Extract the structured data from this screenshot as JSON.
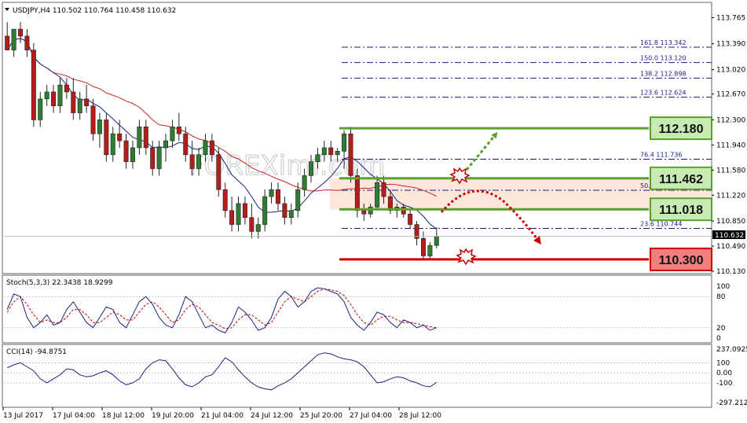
{
  "main_header": "USDJPY,H4  110.502 110.764 110.458 110.632",
  "stoch_header": "Stoch(5,3,3) 22.3438 18.9299",
  "cci_header": "CCI(14) -94.8751",
  "watermark": "FOREXimf.com",
  "price_tag": "110.632",
  "colors": {
    "bull": "#2e7d32",
    "bear": "#b71c1c",
    "ma_fast": "#1a237e",
    "ma_slow": "#c62828",
    "level_green": "#5aa02c",
    "level_red": "#cc0000",
    "fib": "#1a1a8c",
    "box_green": "#c8eab4",
    "box_red": "#f08080",
    "zone": "#fbe3d3"
  },
  "chart_data": [
    {
      "type": "candlestick",
      "symbol": "USDJPY",
      "timeframe": "H4",
      "ylim": [
        110.13,
        113.95
      ],
      "y_ticks": [
        "113.765",
        "113.390",
        "113.020",
        "112.670",
        "112.300",
        "111.940",
        "111.580",
        "111.220",
        "110.850",
        "110.490",
        "110.130"
      ],
      "x_ticks": [
        "13 Jul 2017",
        "17 Jul 04:00",
        "18 Jul 12:00",
        "19 Jul 20:00",
        "21 Jul 04:00",
        "24 Jul 12:00",
        "25 Jul 20:00",
        "27 Jul 04:00",
        "28 Jul 12:00"
      ],
      "candles": [
        [
          113.5,
          113.7,
          113.4,
          113.3
        ],
        [
          113.3,
          113.6,
          113.2,
          113.6
        ],
        [
          113.6,
          113.7,
          113.4,
          113.5
        ],
        [
          113.5,
          113.6,
          113.2,
          113.3
        ],
        [
          113.3,
          113.4,
          112.2,
          112.3
        ],
        [
          112.3,
          112.7,
          112.2,
          112.6
        ],
        [
          112.6,
          112.8,
          112.5,
          112.7
        ],
        [
          112.7,
          112.8,
          112.4,
          112.5
        ],
        [
          112.5,
          112.9,
          112.4,
          112.8
        ],
        [
          112.8,
          112.9,
          112.6,
          112.7
        ],
        [
          112.7,
          112.9,
          112.3,
          112.4
        ],
        [
          112.4,
          112.7,
          112.3,
          112.6
        ],
        [
          112.6,
          112.8,
          112.4,
          112.5
        ],
        [
          112.5,
          112.6,
          112.0,
          112.1
        ],
        [
          112.1,
          112.4,
          111.9,
          112.3
        ],
        [
          112.3,
          112.4,
          111.7,
          111.8
        ],
        [
          111.8,
          112.2,
          111.7,
          112.1
        ],
        [
          112.1,
          112.3,
          111.9,
          112.0
        ],
        [
          112.0,
          112.1,
          111.6,
          111.7
        ],
        [
          111.7,
          112.0,
          111.6,
          111.9
        ],
        [
          111.9,
          112.3,
          111.8,
          112.2
        ],
        [
          112.2,
          112.3,
          111.8,
          111.9
        ],
        [
          111.9,
          112.0,
          111.5,
          111.6
        ],
        [
          111.6,
          112.0,
          111.5,
          111.9
        ],
        [
          111.9,
          112.1,
          111.7,
          112.0
        ],
        [
          112.0,
          112.3,
          111.9,
          112.2
        ],
        [
          112.2,
          112.4,
          112.0,
          112.1
        ],
        [
          112.1,
          112.2,
          111.7,
          111.8
        ],
        [
          111.8,
          112.0,
          111.5,
          111.6
        ],
        [
          111.6,
          111.9,
          111.5,
          111.8
        ],
        [
          111.8,
          112.1,
          111.7,
          112.0
        ],
        [
          112.0,
          112.1,
          111.7,
          111.8
        ],
        [
          111.8,
          111.9,
          111.2,
          111.3
        ],
        [
          111.3,
          111.4,
          110.9,
          111.0
        ],
        [
          111.0,
          111.2,
          110.7,
          110.8
        ],
        [
          110.8,
          111.2,
          110.7,
          111.1
        ],
        [
          111.1,
          111.2,
          110.8,
          110.9
        ],
        [
          110.9,
          111.1,
          110.6,
          110.7
        ],
        [
          110.7,
          110.9,
          110.6,
          110.8
        ],
        [
          110.8,
          111.3,
          110.7,
          111.2
        ],
        [
          111.2,
          111.4,
          111.1,
          111.3
        ],
        [
          111.3,
          111.4,
          111.0,
          111.1
        ],
        [
          111.1,
          111.2,
          110.8,
          110.9
        ],
        [
          110.9,
          111.1,
          110.8,
          111.0
        ],
        [
          111.0,
          111.4,
          110.9,
          111.3
        ],
        [
          111.3,
          111.6,
          111.2,
          111.5
        ],
        [
          111.5,
          111.8,
          111.4,
          111.7
        ],
        [
          111.7,
          111.9,
          111.6,
          111.8
        ],
        [
          111.8,
          112.0,
          111.7,
          111.9
        ],
        [
          111.9,
          112.0,
          111.7,
          111.8
        ],
        [
          111.8,
          111.9,
          111.7,
          111.85
        ],
        [
          111.85,
          112.15,
          111.6,
          112.1
        ],
        [
          112.1,
          112.2,
          111.4,
          111.5
        ],
        [
          111.5,
          111.6,
          110.9,
          111.0
        ],
        [
          111.0,
          111.1,
          110.85,
          110.95
        ],
        [
          110.95,
          111.1,
          110.9,
          111.05
        ],
        [
          111.05,
          111.5,
          111.0,
          111.4
        ],
        [
          111.4,
          111.5,
          111.1,
          111.2
        ],
        [
          111.2,
          111.3,
          110.95,
          111.0
        ],
        [
          111.0,
          111.1,
          110.9,
          111.05
        ],
        [
          111.05,
          111.1,
          110.9,
          110.95
        ],
        [
          110.95,
          111.0,
          110.75,
          110.8
        ],
        [
          110.8,
          110.85,
          110.5,
          110.6
        ],
        [
          110.6,
          110.7,
          110.3,
          110.35
        ],
        [
          110.35,
          110.55,
          110.3,
          110.5
        ],
        [
          110.5,
          110.76,
          110.458,
          110.632
        ]
      ],
      "levels": [
        {
          "label": "112.180",
          "value": 112.18,
          "kind": "resistance"
        },
        {
          "label": "111.462",
          "value": 111.462,
          "kind": "resistance"
        },
        {
          "label": "111.018",
          "value": 111.018,
          "kind": "pivot"
        },
        {
          "label": "110.300",
          "value": 110.3,
          "kind": "support"
        }
      ],
      "fib_levels": [
        {
          "label": "161.8  113.342",
          "value": 113.342
        },
        {
          "label": "150.0  113.120",
          "value": 113.12
        },
        {
          "label": "138.2  112.898",
          "value": 112.898
        },
        {
          "label": "123.6  112.624",
          "value": 112.624
        },
        {
          "label": "76.4   111.736",
          "value": 111.736
        },
        {
          "label": "50.0   111.2?",
          "value": 111.29
        },
        {
          "label": "23.6   110.744",
          "value": 110.744
        }
      ]
    },
    {
      "type": "line",
      "name": "Stoch(5,3,3)",
      "ylim": [
        0,
        100
      ],
      "y_ticks": [
        "100",
        "80",
        "20",
        "0"
      ],
      "k": [
        55,
        85,
        80,
        40,
        20,
        30,
        45,
        25,
        30,
        55,
        70,
        50,
        30,
        20,
        40,
        60,
        55,
        30,
        20,
        45,
        70,
        80,
        65,
        40,
        25,
        20,
        45,
        80,
        70,
        45,
        20,
        25,
        15,
        10,
        30,
        60,
        50,
        35,
        15,
        20,
        40,
        75,
        90,
        80,
        60,
        70,
        90,
        97,
        95,
        90,
        85,
        70,
        40,
        25,
        15,
        30,
        50,
        45,
        30,
        20,
        35,
        30,
        20,
        25,
        15,
        20
      ],
      "d": [
        50,
        70,
        80,
        65,
        45,
        30,
        35,
        30,
        30,
        40,
        55,
        55,
        45,
        30,
        30,
        40,
        50,
        45,
        35,
        35,
        50,
        65,
        70,
        60,
        45,
        30,
        35,
        55,
        65,
        60,
        45,
        30,
        25,
        18,
        20,
        35,
        45,
        45,
        35,
        25,
        30,
        50,
        70,
        80,
        75,
        70,
        80,
        90,
        95,
        93,
        90,
        82,
        65,
        45,
        30,
        25,
        35,
        42,
        42,
        35,
        30,
        30,
        28,
        25,
        22,
        20
      ]
    },
    {
      "type": "line",
      "name": "CCI(14)",
      "ylim": [
        -297.2122,
        237.0925
      ],
      "y_ticks": [
        "237.0925",
        "100",
        "0.00",
        "-100",
        "-297.2122"
      ],
      "values": [
        50,
        80,
        100,
        60,
        20,
        -60,
        -100,
        -60,
        -20,
        40,
        30,
        -20,
        -40,
        -30,
        0,
        20,
        -20,
        -80,
        -120,
        -100,
        -60,
        40,
        100,
        130,
        120,
        40,
        -50,
        -120,
        -140,
        -100,
        -40,
        -20,
        60,
        150,
        110,
        30,
        -40,
        -100,
        -140,
        -160,
        -170,
        -130,
        -100,
        -60,
        0,
        60,
        120,
        180,
        200,
        190,
        160,
        140,
        130,
        110,
        60,
        -20,
        -100,
        -90,
        -60,
        -40,
        -50,
        -80,
        -100,
        -130,
        -140,
        -95
      ]
    }
  ]
}
